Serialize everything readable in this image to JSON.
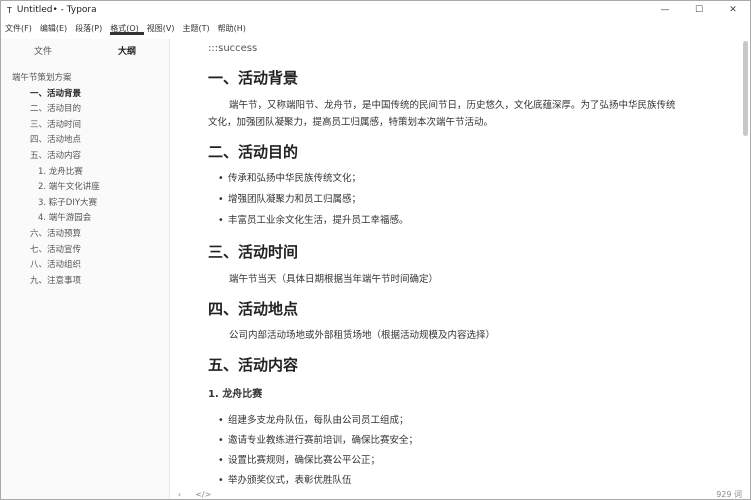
{
  "window": {
    "title": "Untitled• - Typora",
    "icon": "T"
  },
  "menu": [
    "文件(F)",
    "编辑(E)",
    "段落(P)",
    "格式(O)",
    "视图(V)",
    "主题(T)",
    "帮助(H)"
  ],
  "sidebar": {
    "tabs": [
      "文件",
      "大纲"
    ],
    "outline": [
      {
        "text": "端午节策划方案",
        "level": 1
      },
      {
        "text": "一、活动背景",
        "level": 2,
        "current": true
      },
      {
        "text": "二、活动目的",
        "level": 2
      },
      {
        "text": "三、活动时间",
        "level": 2
      },
      {
        "text": "四、活动地点",
        "level": 2
      },
      {
        "text": "五、活动内容",
        "level": 2
      },
      {
        "text": "1. 龙舟比赛",
        "level": 3
      },
      {
        "text": "2. 端午文化讲座",
        "level": 3
      },
      {
        "text": "3. 粽子DIY大赛",
        "level": 3
      },
      {
        "text": "4. 端午游园会",
        "level": 3
      },
      {
        "text": "六、活动预算",
        "level": 2
      },
      {
        "text": "七、活动宣传",
        "level": 2
      },
      {
        "text": "八、活动组织",
        "level": 2
      },
      {
        "text": "九、注意事项",
        "level": 2
      }
    ]
  },
  "content": {
    "raw": ":::success",
    "h1": "一、活动背景",
    "p1": "端午节，又称端阳节、龙舟节，是中国传统的民间节日，历史悠久，文化底蕴深厚。为了弘扬中华民族传统文化，加强团队凝聚力，提高员工归属感，特策划本次端午节活动。",
    "h2": "二、活动目的",
    "goals": [
      "传承和弘扬中华民族传统文化；",
      "增强团队凝聚力和员工归属感；",
      "丰富员工业余文化生活，提升员工幸福感。"
    ],
    "h3": "三、活动时间",
    "p3": "端午节当天（具体日期根据当年端午节时间确定）",
    "h4": "四、活动地点",
    "p4": "公司内部活动场地或外部租赁场地（根据活动规模及内容选择）",
    "h5": "五、活动内容",
    "sub1": "1. 龙舟比赛",
    "dragon": [
      "组建多支龙舟队伍，每队由公司员工组成；",
      "邀请专业教练进行赛前培训，确保比赛安全；",
      "设置比赛规则，确保比赛公平公正；",
      "举办颁奖仪式，表彰优胜队伍"
    ]
  },
  "footer": {
    "word_count": "929 词"
  }
}
